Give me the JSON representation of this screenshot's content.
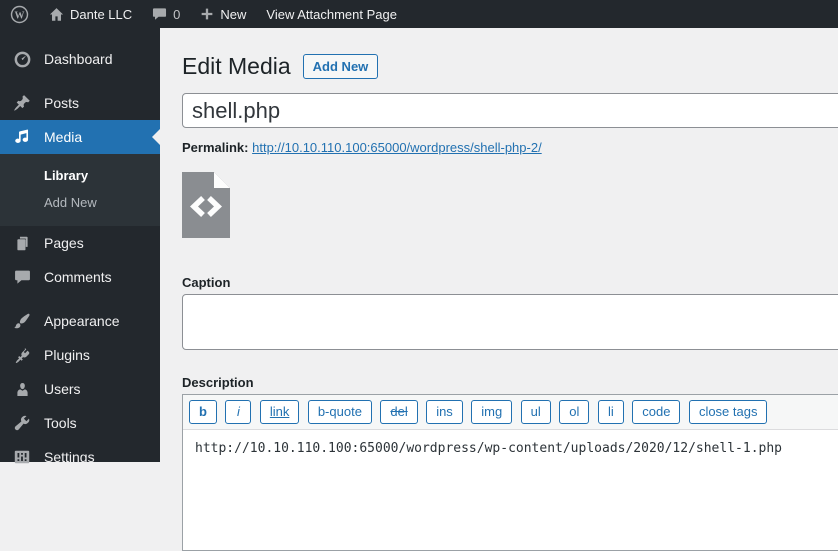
{
  "admin_bar": {
    "site_name": "Dante LLC",
    "comments_count": "0",
    "new_label": "New",
    "view_attachment_label": "View Attachment Page",
    "icons": [
      "wordpress-logo-icon",
      "home-icon",
      "comment-icon",
      "plus-icon"
    ]
  },
  "sidebar": {
    "items": [
      {
        "label": "Dashboard",
        "icon": "dashboard-icon"
      },
      {
        "label": "Posts",
        "icon": "pushpin-icon"
      },
      {
        "label": "Media",
        "icon": "media-note-icon",
        "active": true
      },
      {
        "label": "Pages",
        "icon": "pages-icon"
      },
      {
        "label": "Comments",
        "icon": "comment-icon"
      },
      {
        "label": "Appearance",
        "icon": "paintbrush-icon"
      },
      {
        "label": "Plugins",
        "icon": "plugin-icon"
      },
      {
        "label": "Users",
        "icon": "user-icon"
      },
      {
        "label": "Tools",
        "icon": "wrench-icon"
      },
      {
        "label": "Settings",
        "icon": "settings-panel-icon"
      }
    ],
    "media_submenu": [
      {
        "label": "Library",
        "current": true
      },
      {
        "label": "Add New",
        "current": false
      }
    ]
  },
  "main": {
    "page_title": "Edit Media",
    "add_new_button": "Add New",
    "title_field_value": "shell.php",
    "permalink_label": "Permalink:",
    "permalink_url": "http://10.10.110.100:65000/wordpress/shell-php-2/",
    "attachment_icon": "code-file-icon",
    "caption": {
      "label": "Caption",
      "value": ""
    },
    "description": {
      "label": "Description",
      "value": "http://10.10.110.100:65000/wordpress/wp-content/uploads/2020/12/shell-1.php",
      "quicktags": [
        "b",
        "i",
        "link",
        "b-quote",
        "del",
        "ins",
        "img",
        "ul",
        "ol",
        "li",
        "code",
        "close tags"
      ]
    }
  },
  "colors": {
    "accent_blue": "#2271b1",
    "admin_bar_bg": "#23282d",
    "sidebar_bg": "#23282d",
    "submenu_bg": "#2c3338",
    "content_bg": "#f0f0f1",
    "icon_gray": "#a7aaad",
    "heading_text": "#1d2327",
    "input_border": "#8c8f94"
  }
}
